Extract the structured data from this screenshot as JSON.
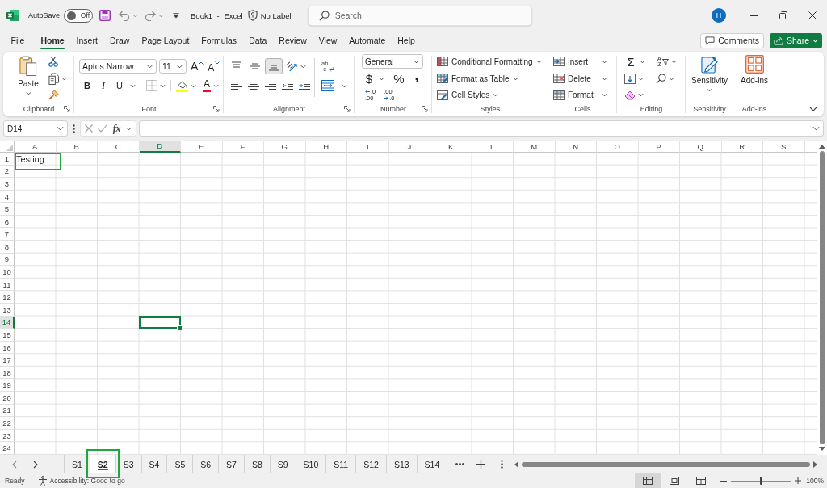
{
  "title_bar": {
    "autosave": {
      "label": "AutoSave",
      "on": false,
      "state_text": "Off"
    },
    "title": "Book1 - Excel",
    "sensitivity": "No Label",
    "search": {
      "placeholder": "Search"
    },
    "avatar": "H"
  },
  "menu_tabs": [
    {
      "label": "File",
      "selected": false
    },
    {
      "label": "Home",
      "selected": true
    },
    {
      "label": "Insert",
      "selected": false
    },
    {
      "label": "Draw",
      "selected": false
    },
    {
      "label": "Page Layout",
      "selected": false
    },
    {
      "label": "Formulas",
      "selected": false
    },
    {
      "label": "Data",
      "selected": false
    },
    {
      "label": "Review",
      "selected": false
    },
    {
      "label": "View",
      "selected": false
    },
    {
      "label": "Automate",
      "selected": false
    },
    {
      "label": "Help",
      "selected": false
    }
  ],
  "comments_button": "Comments",
  "share_button": "Share",
  "ribbon": {
    "clipboard": {
      "label": "Clipboard",
      "paste": "Paste"
    },
    "font": {
      "label": "Font",
      "font_name": "Aptos Narrow",
      "font_size": "11",
      "grow": "A",
      "shrink": "A",
      "bold": "B",
      "italic": "I",
      "underline": "U",
      "font_color": "A"
    },
    "alignment": {
      "label": "Alignment",
      "vertical": [
        {
          "selected": false
        },
        {
          "selected": false
        },
        {
          "selected": true
        }
      ],
      "wrap_text": [
        "ab",
        "c"
      ]
    },
    "number": {
      "label": "Number",
      "format": "General",
      "currency": "$",
      "percent": "%",
      "comma": ",",
      "increase_decimal": [
        ".0",
        ".00"
      ],
      "decrease_decimal": [
        ".00",
        ".0"
      ]
    },
    "styles": {
      "label": "Styles",
      "items": [
        "Conditional Formatting",
        "Format as Table",
        "Cell Styles"
      ]
    },
    "cells": {
      "label": "Cells",
      "items": [
        "Insert",
        "Delete",
        "Format"
      ]
    },
    "editing": {
      "label": "Editing",
      "autosum": "Σ",
      "sort": [
        "A",
        "Z"
      ]
    },
    "sensitivity": {
      "label": "Sensitivity",
      "button": "Sensitivity"
    },
    "addins": {
      "label": "Add-ins",
      "button": "Add-ins"
    }
  },
  "formula_bar": {
    "name_box": "D14",
    "function": "fx"
  },
  "grid": {
    "columns": [
      {
        "label": "A",
        "selected": false
      },
      {
        "label": "B",
        "selected": false
      },
      {
        "label": "C",
        "selected": false
      },
      {
        "label": "D",
        "selected": true
      },
      {
        "label": "E",
        "selected": false
      },
      {
        "label": "F",
        "selected": false
      },
      {
        "label": "G",
        "selected": false
      },
      {
        "label": "H",
        "selected": false
      },
      {
        "label": "I",
        "selected": false
      },
      {
        "label": "J",
        "selected": false
      },
      {
        "label": "K",
        "selected": false
      },
      {
        "label": "L",
        "selected": false
      },
      {
        "label": "M",
        "selected": false
      },
      {
        "label": "N",
        "selected": false
      },
      {
        "label": "O",
        "selected": false
      },
      {
        "label": "P",
        "selected": false
      },
      {
        "label": "Q",
        "selected": false
      },
      {
        "label": "R",
        "selected": false
      },
      {
        "label": "S",
        "selected": false
      }
    ],
    "rows": [
      {
        "header": "1",
        "selected": false,
        "cells": [
          {
            "value": "Testing",
            "highlighted": true
          }
        ]
      },
      {
        "header": "2",
        "selected": false
      },
      {
        "header": "3",
        "selected": false
      },
      {
        "header": "4",
        "selected": false
      },
      {
        "header": "5",
        "selected": false
      },
      {
        "header": "6",
        "selected": false
      },
      {
        "header": "7",
        "selected": false
      },
      {
        "header": "8",
        "selected": false
      },
      {
        "header": "9",
        "selected": false
      },
      {
        "header": "10",
        "selected": false
      },
      {
        "header": "11",
        "selected": false
      },
      {
        "header": "12",
        "selected": false
      },
      {
        "header": "13",
        "selected": false
      },
      {
        "header": "14",
        "selected": true
      },
      {
        "header": "15",
        "selected": false
      },
      {
        "header": "16",
        "selected": false
      },
      {
        "header": "17",
        "selected": false
      },
      {
        "header": "18",
        "selected": false
      },
      {
        "header": "19",
        "selected": false
      },
      {
        "header": "20",
        "selected": false
      },
      {
        "header": "21",
        "selected": false
      },
      {
        "header": "22",
        "selected": false
      },
      {
        "header": "23",
        "selected": false
      },
      {
        "header": "24",
        "selected": false
      }
    ]
  },
  "sheet_tabs": [
    {
      "label": "S1",
      "selected": false,
      "highlighted": false
    },
    {
      "label": "S2",
      "selected": true,
      "highlighted": true
    },
    {
      "label": "S3",
      "selected": false,
      "highlighted": false
    },
    {
      "label": "S4",
      "selected": false,
      "highlighted": false
    },
    {
      "label": "S5",
      "selected": false,
      "highlighted": false
    },
    {
      "label": "S6",
      "selected": false,
      "highlighted": false
    },
    {
      "label": "S7",
      "selected": false,
      "highlighted": false
    },
    {
      "label": "S8",
      "selected": false,
      "highlighted": false
    },
    {
      "label": "S9",
      "selected": false,
      "highlighted": false
    },
    {
      "label": "S10",
      "selected": false,
      "highlighted": false
    },
    {
      "label": "S11",
      "selected": false,
      "highlighted": false
    },
    {
      "label": "S12",
      "selected": false,
      "highlighted": false
    },
    {
      "label": "S13",
      "selected": false,
      "highlighted": false
    },
    {
      "label": "S14",
      "selected": false,
      "highlighted": false
    }
  ],
  "status_bar": {
    "status": "Ready",
    "accessibility": "Accessibility: Good to go",
    "views": [
      {
        "selected": true
      },
      {
        "selected": false
      },
      {
        "selected": false
      }
    ],
    "zoom": {
      "level": 0.5,
      "reading": "100%"
    }
  }
}
